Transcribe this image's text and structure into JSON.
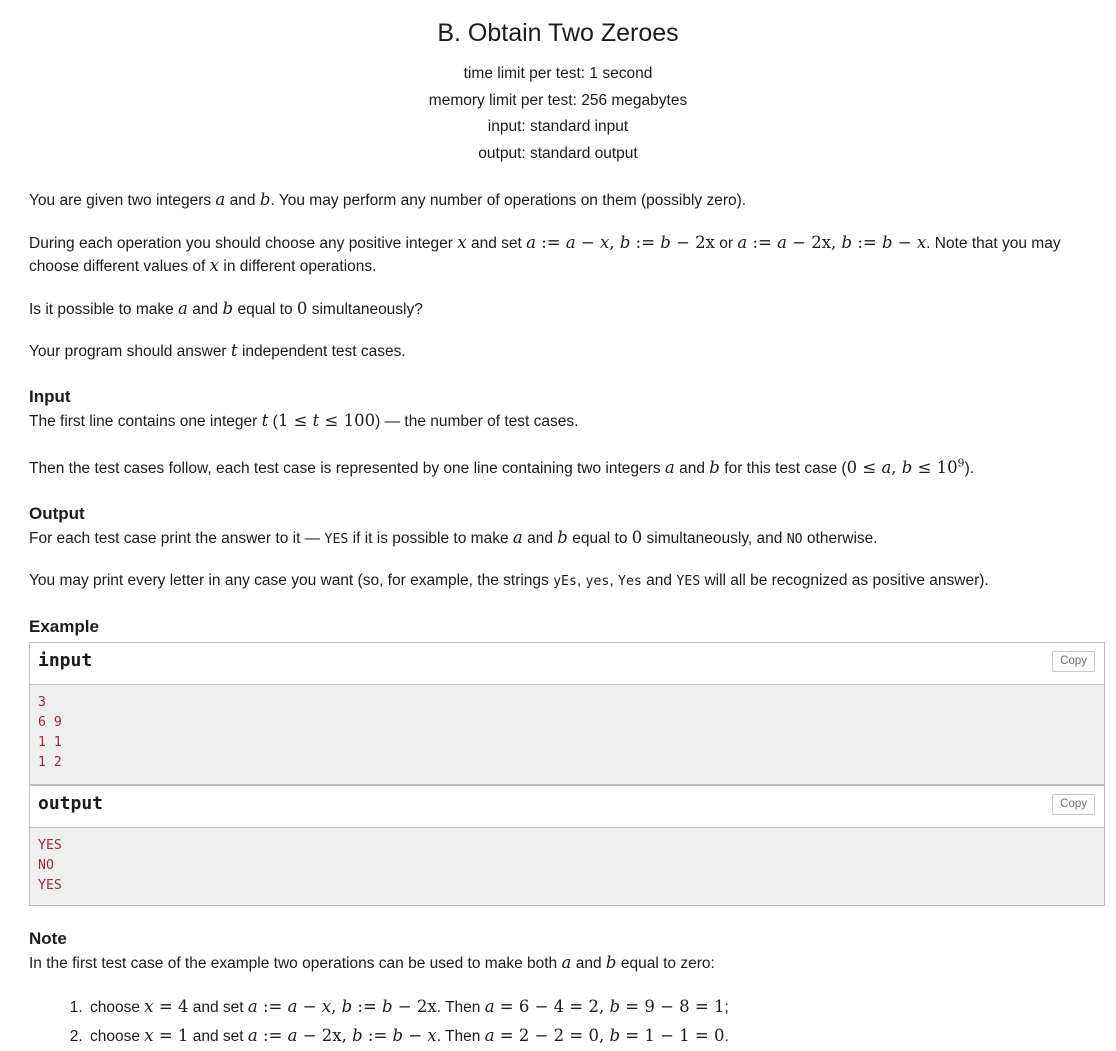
{
  "problem": {
    "title": "B. Obtain Two Zeroes",
    "limits": [
      "time limit per test: 1 second",
      "memory limit per test: 256 megabytes",
      "input: standard input",
      "output: standard output"
    ]
  },
  "statement": {
    "p1_a": "You are given two integers ",
    "p1_var_a": "a",
    "p1_b": " and ",
    "p1_var_b": "b",
    "p1_c": ". You may perform any number of operations on them (possibly zero).",
    "p2_a": "During each operation you should choose any positive integer ",
    "p2_var_x": "x",
    "p2_b": " and set ",
    "p2_formula1": "a := a − x, b := b − 2x",
    "p2_c": " or ",
    "p2_formula2": "a := a − 2x, b := b − x",
    "p2_d": ". Note that you may choose different values of ",
    "p2_var_x2": "x",
    "p2_e": " in different operations.",
    "p3_a": "Is it possible to make ",
    "p3_var_a": "a",
    "p3_b": " and ",
    "p3_var_b": "b",
    "p3_c": " equal to ",
    "p3_zero": "0",
    "p3_d": " simultaneously?",
    "p4_a": "Your program should answer ",
    "p4_var_t": "t",
    "p4_b": " independent test cases."
  },
  "input_section": {
    "heading": "Input",
    "l1_a": "The first line contains one integer ",
    "l1_var_t": "t",
    "l1_b": " (",
    "l1_range": "1 ≤ t ≤ 100",
    "l1_c": ") — the number of test cases.",
    "l2_a": "Then the test cases follow, each test case is represented by one line containing two integers ",
    "l2_var_a": "a",
    "l2_b": " and ",
    "l2_var_b": "b",
    "l2_c": " for this test case (",
    "l2_range_pre": "0 ≤ a, b ≤ 10",
    "l2_range_exp": "9",
    "l2_d": ")."
  },
  "output_section": {
    "heading": "Output",
    "l1_a": "For each test case print the answer to it — ",
    "l1_yes": "YES",
    "l1_b": " if it is possible to make ",
    "l1_var_a": "a",
    "l1_c": " and ",
    "l1_var_b": "b",
    "l1_d": " equal to ",
    "l1_zero": "0",
    "l1_e": " simultaneously, and ",
    "l1_no": "NO",
    "l1_f": " otherwise.",
    "l2_a": "You may print every letter in any case you want (so, for example, the strings ",
    "l2_s1": "yEs",
    "l2_sep1": ", ",
    "l2_s2": "yes",
    "l2_sep2": ", ",
    "l2_s3": "Yes",
    "l2_b": " and ",
    "l2_s4": "YES",
    "l2_c": " will all be recognized as positive answer)."
  },
  "example": {
    "heading": "Example",
    "input_label": "input",
    "output_label": "output",
    "copy_label": "Copy",
    "input_data": "3\n6 9\n1 1\n1 2",
    "output_data": "YES\nNO\nYES"
  },
  "note": {
    "heading": "Note",
    "intro_a": "In the first test case of the example two operations can be used to make both ",
    "intro_var_a": "a",
    "intro_b": " and ",
    "intro_var_b": "b",
    "intro_c": " equal to zero:",
    "items": [
      {
        "pre": "choose ",
        "choose": "x = 4",
        "mid": " and set ",
        "formula": "a := a − x, b := b − 2x",
        "then": ". Then ",
        "result": "a = 6 − 4 = 2, b = 9 − 8 = 1",
        "end": ";"
      },
      {
        "pre": "choose ",
        "choose": "x = 1",
        "mid": " and set ",
        "formula": "a := a − 2x, b := b − x",
        "then": ". Then ",
        "result": "a = 2 − 2 = 0, b = 1 − 1 = 0",
        "end": "."
      }
    ]
  },
  "colors": {
    "sample_text": "#9c2b2b",
    "sample_bg": "#efefef",
    "border": "#bdbdbd",
    "text": "#1c1c1c"
  }
}
